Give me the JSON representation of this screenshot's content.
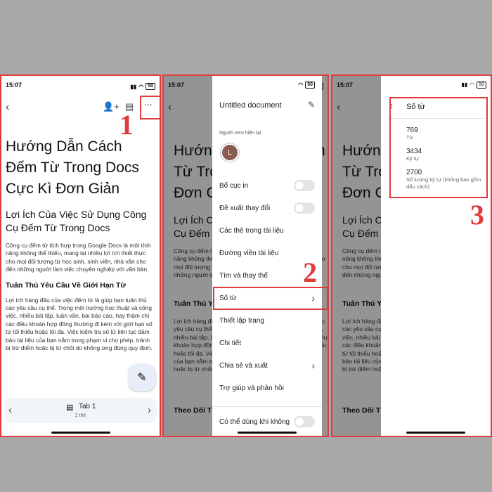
{
  "status": {
    "time": "15:07",
    "battery": "50"
  },
  "panel1": {
    "doc_title": "Hướng Dẫn Cách Đếm Từ Trong Docs Cực Kì Đơn Giản",
    "subtitle": "Lợi Ích Của Việc Sử Dụng Công Cụ Đếm Từ Trong Docs",
    "para1": "Công cụ đếm từ tích hợp trong Google Docs là một tính năng không thể thiếu, mang lại nhiều lợi ích thiết thực cho mọi đối tượng từ học sinh, sinh viên, nhà văn cho đến những người làm việc chuyên nghiệp với văn bản.",
    "heading2": "Tuân Thủ Yêu Cầu Về Giới Hạn Từ",
    "para2": "Lợi ích hàng đầu của việc đếm từ là giúp bạn tuân thủ các yêu cầu cụ thể. Trong môi trường học thuật và công việc, nhiều bài tập, luận văn, bài báo cáo, hay thậm chí các điều khoản hợp đồng thường đi kèm với giới hạn số từ tối thiểu hoặc tối đa. Việc kiểm tra số từ liên tục đảm bảo tài liệu của bạn nằm trong phạm vi cho phép, tránh bị trừ điểm hoặc bị từ chối do không ứng đúng quy định.",
    "tab_label": "Tab 1",
    "tab_sub": "2 thẻ",
    "step": "1"
  },
  "panel2": {
    "sheet_title": "Untitled document",
    "viewers_label": "Người xem hiện tại",
    "avatar_letter": "L",
    "menu": [
      {
        "label": "Bố cục in",
        "kind": "toggle"
      },
      {
        "label": "Đề xuất thay đổi",
        "kind": "toggle"
      },
      {
        "label": "Các thẻ trong tài liệu",
        "kind": "plain"
      },
      {
        "label": "Đường viền tài liệu",
        "kind": "plain"
      },
      {
        "label": "Tìm và thay thế",
        "kind": "plain"
      },
      {
        "label": "Số từ",
        "kind": "chevron"
      },
      {
        "label": "Thiết lập trang",
        "kind": "plain"
      },
      {
        "label": "Chi tiết",
        "kind": "plain"
      },
      {
        "label": "Chia sẻ và xuất",
        "kind": "chevron"
      },
      {
        "label": "Trợ giúp và phản hồi",
        "kind": "plain"
      },
      {
        "label": "Có thể dùng khi không",
        "kind": "toggle"
      }
    ],
    "bg_heading": "Theo Dõi T",
    "step": "2"
  },
  "panel3": {
    "title": "Số từ",
    "stats": [
      {
        "value": "769",
        "label": "Từ"
      },
      {
        "value": "3434",
        "label": "Ký tự"
      },
      {
        "value": "2700",
        "label": "Số lượng ký tự (không bao gồm dấu cách)"
      }
    ],
    "step": "3"
  },
  "colors": {
    "annotation": "#e03b3b",
    "link": "#1a73e8"
  }
}
